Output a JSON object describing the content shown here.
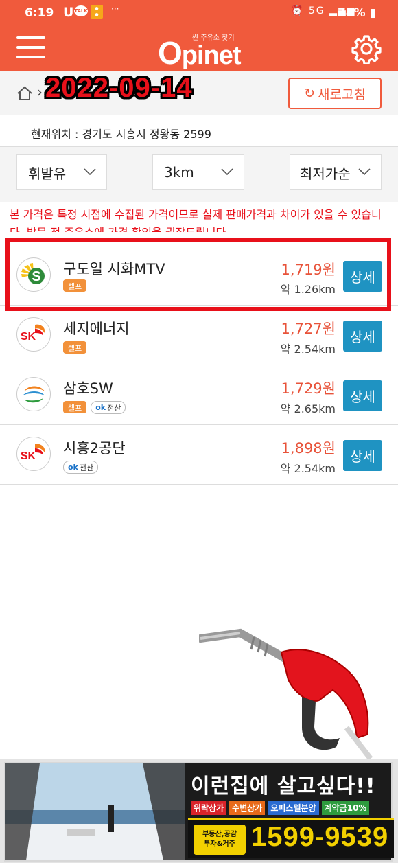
{
  "status_bar": {
    "time": "6:19",
    "carrier": "U⁺",
    "battery": "74%",
    "signal_label": "5G"
  },
  "app": {
    "logo_sub": "싼 주유소 찾기",
    "logo_main_first": "O",
    "logo_main_rest": "pinet",
    "brand_color": "#f05a3c"
  },
  "header": {
    "date": "2022-09-14",
    "refresh_label": "새로고침"
  },
  "location": {
    "text": "현재위치 : 경기도 시흥시 정왕동 2599"
  },
  "filters": {
    "fuel": "휘발유",
    "radius": "3km",
    "sort": "최저가순"
  },
  "notice": {
    "text": "본 가격은 특정 시점에 수집된 가격이므로 실제 판매가격과 차이가 있을 수 있습니다. 방문 전 주유소에 가격 확인을 권장드립니다."
  },
  "stations": [
    {
      "name": "구도일 시화MTV",
      "brand": "s-oil",
      "price": "1,719원",
      "distance": "약 1.26km",
      "self": "셀프",
      "card": "",
      "detail": "상세"
    },
    {
      "name": "세지에너지",
      "brand": "sk",
      "price": "1,727원",
      "distance": "약 2.54km",
      "self": "셀프",
      "card": "",
      "detail": "상세"
    },
    {
      "name": "삼호SW",
      "brand": "gs",
      "price": "1,729원",
      "distance": "약 2.65km",
      "self": "셀프",
      "card": "전산",
      "detail": "상세"
    },
    {
      "name": "시흥2공단",
      "brand": "sk",
      "price": "1,898원",
      "distance": "약 2.54km",
      "self": "",
      "card": "전산",
      "detail": "상세"
    }
  ],
  "ad": {
    "title": "이런집에 살고싶다!!",
    "tags": [
      "위락상가",
      "수변상가",
      "오피스텔분양",
      "계약금10%"
    ],
    "badge_line1": "부동산,공감",
    "badge_line2": "투자&거주",
    "phone": "1599-9539"
  }
}
